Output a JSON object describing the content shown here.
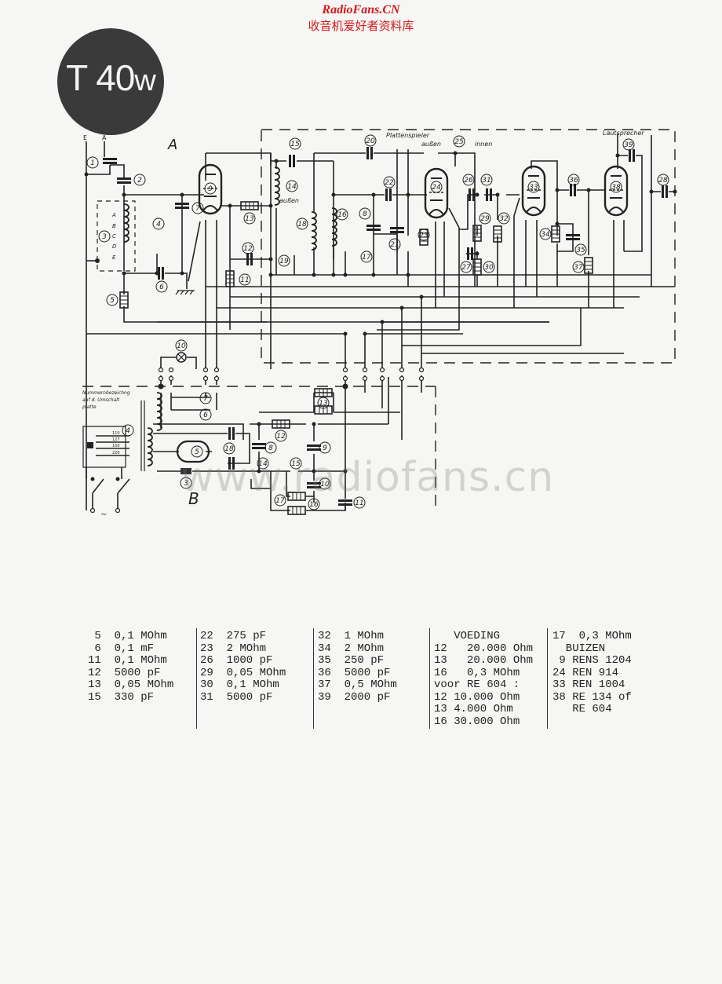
{
  "watermark": {
    "site_en": "RadioFans.CN",
    "site_cn": "收音机爱好者资料库",
    "overlay": "www.radiofans.cn"
  },
  "badge": {
    "model": "T 40",
    "suffix": "w"
  },
  "schematic": {
    "section_labels": {
      "a": "A",
      "b": "B"
    },
    "terminals": {
      "e": "E",
      "a": "A"
    },
    "coil_taps": [
      "A",
      "B",
      "C",
      "D",
      "E"
    ],
    "labels": {
      "plattenspieler": "Plattenspieler",
      "aussen_top": "außen",
      "innen": "innen",
      "aussen_coil": "außen",
      "lautsprecher": "Lautsprecher",
      "plate_note_1": "Nummernbezeichng",
      "plate_note_2": "auf d. Umschalt",
      "plate_note_3": "platte",
      "mains": "~"
    },
    "part_numbers_a": [
      "1",
      "2",
      "3",
      "4",
      "5",
      "6",
      "7",
      "9",
      "10",
      "11",
      "12",
      "13",
      "14",
      "15",
      "16",
      "17",
      "18",
      "19",
      "20",
      "21",
      "22",
      "23",
      "24",
      "25",
      "26",
      "27",
      "28",
      "29",
      "30",
      "31",
      "32",
      "33",
      "34",
      "35",
      "36",
      "37",
      "38",
      "39",
      "8"
    ],
    "part_numbers_b": [
      "3",
      "4",
      "5",
      "6",
      "7",
      "8",
      "9",
      "10",
      "11",
      "12",
      "13",
      "14",
      "15",
      "16",
      "17",
      "18"
    ],
    "voltage_taps": [
      "110",
      "127",
      "150",
      "220"
    ]
  },
  "parts_list": {
    "col1": [
      {
        "n": "5",
        "v": "0,1 MOhm"
      },
      {
        "n": "6",
        "v": "0,1 mF"
      },
      {
        "n": "11",
        "v": "0,1 MOhm"
      },
      {
        "n": "12",
        "v": "5000 pF"
      },
      {
        "n": "13",
        "v": "0,05 MOhm"
      },
      {
        "n": "15",
        "v": "330 pF"
      }
    ],
    "col2": [
      {
        "n": "22",
        "v": "275 pF"
      },
      {
        "n": "23",
        "v": "2 MOhm"
      },
      {
        "n": "26",
        "v": "1000 pF"
      },
      {
        "n": "29",
        "v": "0,05 MOhm"
      },
      {
        "n": "30",
        "v": "0,1 MOhm"
      },
      {
        "n": "31",
        "v": "5000 pF"
      }
    ],
    "col3": [
      {
        "n": "32",
        "v": "1 MOhm"
      },
      {
        "n": "34",
        "v": "2 MOhm"
      },
      {
        "n": "35",
        "v": "250 pF"
      },
      {
        "n": "36",
        "v": "5000 pF"
      },
      {
        "n": "37",
        "v": "0,5 MOhm"
      },
      {
        "n": "39",
        "v": "2000 pF"
      }
    ],
    "col4": {
      "heading": "VOEDING",
      "rows": [
        {
          "n": "12",
          "v": "20.000 Ohm"
        },
        {
          "n": "13",
          "v": "20.000 Ohm"
        },
        {
          "n": "16",
          "v": "0,3 MOhm"
        }
      ],
      "subheading": "voor RE 604 :",
      "rows2": [
        {
          "n": "12",
          "v": "10.000 Ohm"
        },
        {
          "n": "13",
          "v": "4.000 Ohm"
        },
        {
          "n": "16",
          "v": "30.000 Ohm"
        }
      ]
    },
    "col5": {
      "first": {
        "n": "17",
        "v": "0,3 MOhm"
      },
      "heading": "BUIZEN",
      "tubes": [
        {
          "n": "9",
          "v": "RENS 1204"
        },
        {
          "n": "24",
          "v": "REN 914"
        },
        {
          "n": "33",
          "v": "REN 1004"
        },
        {
          "n": "38",
          "v": "RE 134 of"
        }
      ],
      "tail": "RE 604"
    }
  }
}
